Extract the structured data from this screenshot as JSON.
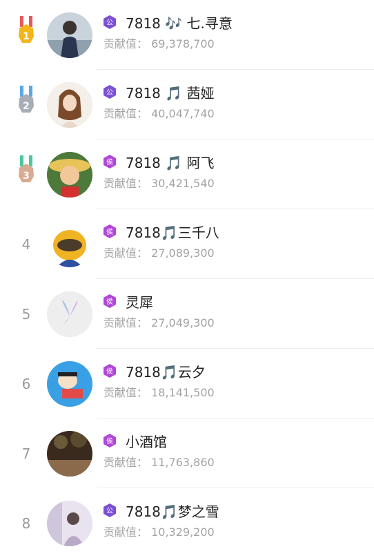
{
  "contrib_label": "贡献值：",
  "rows": [
    {
      "rank": "1",
      "name": "7818 🎶 七.寻意",
      "contribution": "69,378,700",
      "badge": "公",
      "badge_color": "#7b4fd6",
      "medal_color": "#f2b61a",
      "ribbon_color": "#e85a5a"
    },
    {
      "rank": "2",
      "name": "7818 🎵 茜娅",
      "contribution": "40,047,740",
      "badge": "公",
      "badge_color": "#7b4fd6",
      "medal_color": "#a9adb5",
      "ribbon_color": "#5aa7e8"
    },
    {
      "rank": "3",
      "name": "7818 🎵 阿飞",
      "contribution": "30,421,540",
      "badge": "侯",
      "badge_color": "#b146d9",
      "medal_color": "#d8ab92",
      "ribbon_color": "#4cc79a"
    },
    {
      "rank": "4",
      "name": "7818🎵三千八",
      "contribution": "27,089,300",
      "badge": "侯",
      "badge_color": "#b146d9"
    },
    {
      "rank": "5",
      "name": "灵犀",
      "contribution": "27,049,300",
      "badge": "侯",
      "badge_color": "#b146d9"
    },
    {
      "rank": "6",
      "name": "7818🎵云夕",
      "contribution": "18,141,500",
      "badge": "侯",
      "badge_color": "#b146d9"
    },
    {
      "rank": "7",
      "name": "小酒馆",
      "contribution": "11,763,860",
      "badge": "侯",
      "badge_color": "#b146d9"
    },
    {
      "rank": "8",
      "name": "7818🎵梦之雪",
      "contribution": "10,329,200",
      "badge": "公",
      "badge_color": "#7b4fd6"
    }
  ]
}
